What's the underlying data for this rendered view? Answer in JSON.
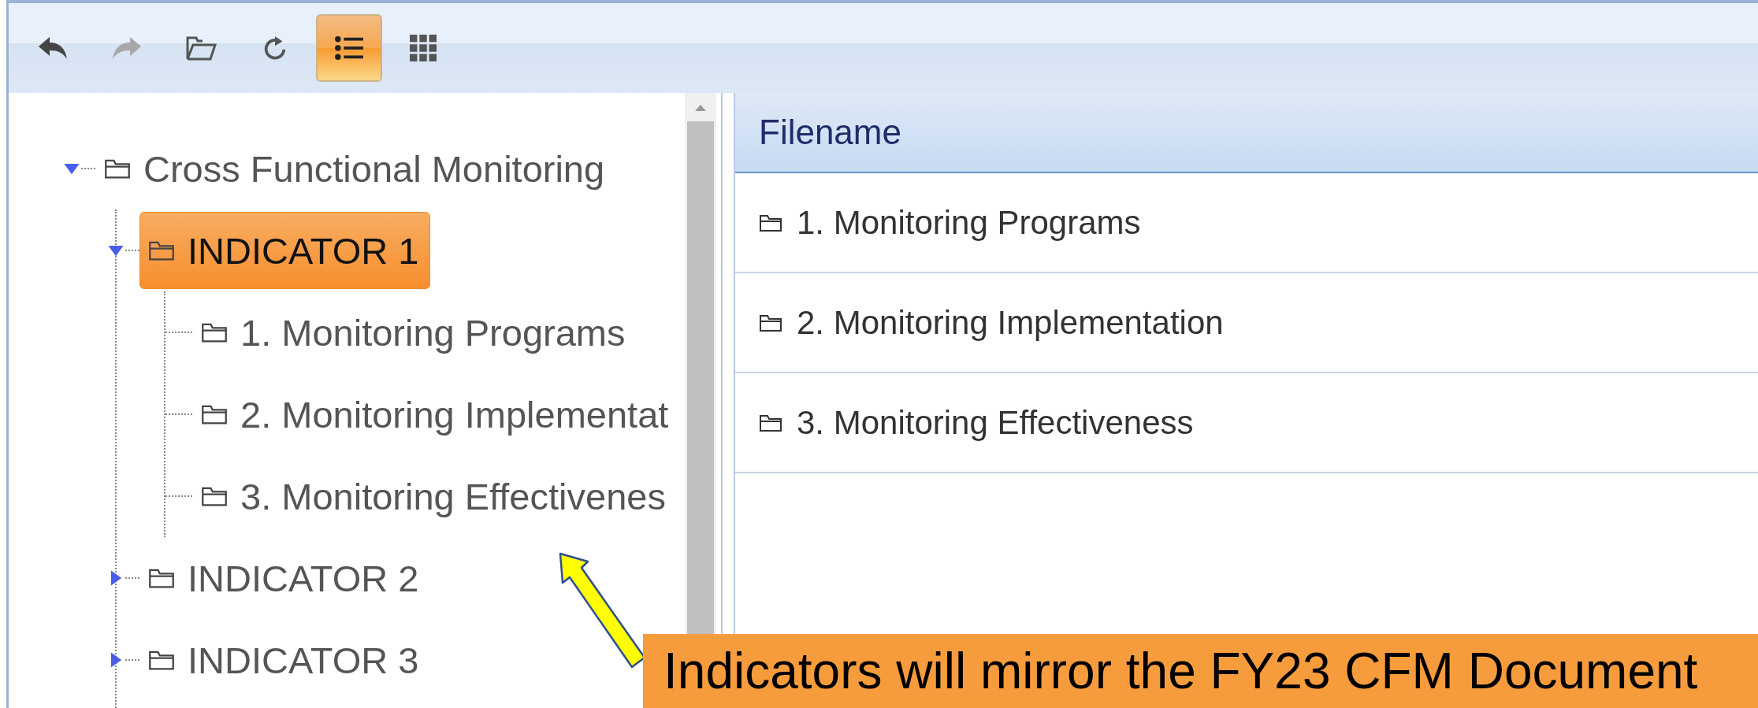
{
  "toolbar": {
    "buttons": [
      {
        "kind": "back",
        "disabled": false
      },
      {
        "kind": "forward",
        "disabled": true
      },
      {
        "kind": "open"
      },
      {
        "kind": "refresh"
      },
      {
        "kind": "list",
        "selected": true
      },
      {
        "kind": "grid",
        "selected": false
      }
    ]
  },
  "tree": [
    {
      "label": "Cross Functional Monitoring",
      "expanded": true,
      "selected": false,
      "children": [
        {
          "label": "INDICATOR 1",
          "expanded": true,
          "selected": true,
          "children": [
            {
              "label": "1. Monitoring Programs",
              "selected": false
            },
            {
              "label": "2. Monitoring Implementat",
              "selected": false
            },
            {
              "label": "3. Monitoring Effectivenes",
              "selected": false
            }
          ]
        },
        {
          "label": "INDICATOR 2",
          "expanded": false,
          "selected": false
        },
        {
          "label": "INDICATOR 3",
          "expanded": false,
          "selected": false
        }
      ]
    }
  ],
  "table": {
    "columns": [
      "Filename"
    ],
    "rows": [
      {
        "filename": "1. Monitoring Programs"
      },
      {
        "filename": "2. Monitoring Implementation"
      },
      {
        "filename": "3. Monitoring Effectiveness"
      }
    ]
  },
  "callout": {
    "text": "Indicators will mirror the FY23 CFM Document"
  }
}
